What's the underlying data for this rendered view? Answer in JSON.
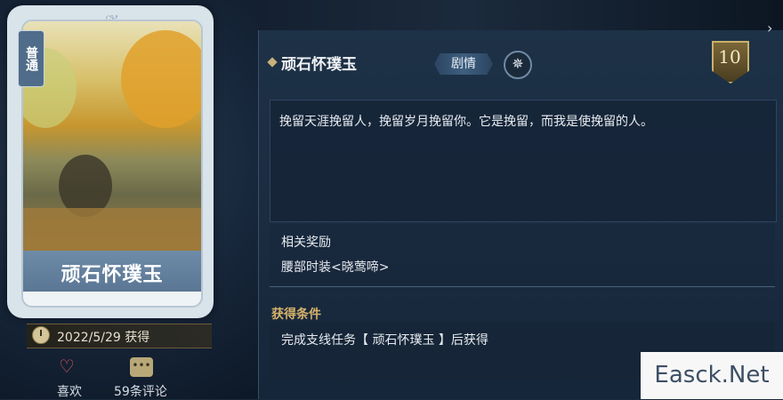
{
  "card": {
    "rarity": "普通",
    "name": "顽石怀璞玉",
    "acquired_date": "2022/5/29 获得"
  },
  "actions": {
    "like_label": "喜欢",
    "comment_label": "59条评论"
  },
  "detail": {
    "title": "顽石怀璞玉",
    "tag": "剧情",
    "level": "10",
    "description": "挽留天涯挽留人，挽留岁月挽留你。它是挽留，而我是使挽留的人。",
    "reward_heading": "相关奖励",
    "reward_item": "腰部时装<晓莺啼>",
    "condition_heading": "获得条件",
    "condition_text": "完成支线任务【 顽石怀璞玉 】后获得"
  },
  "watermark": "Easck.Net",
  "colors": {
    "accent_gold": "#d8b26a",
    "panel_bg": "#1d3147",
    "heart_red": "#e05a5a"
  }
}
